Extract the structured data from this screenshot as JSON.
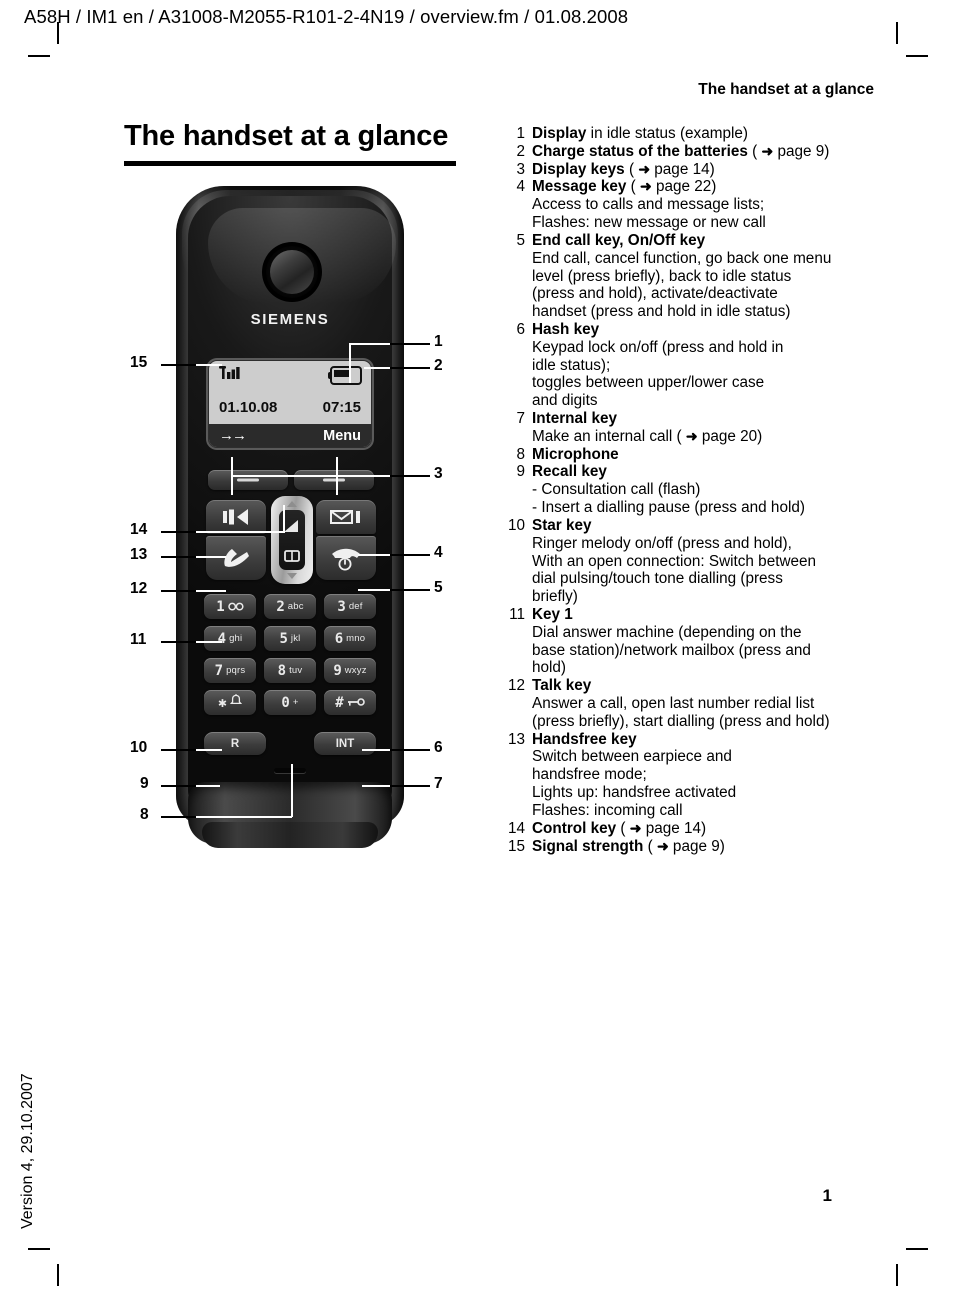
{
  "doc_header": "A58H / IM1 en / A31008-M2055-R101-2-4N19 / overview.fm / 01.08.2008",
  "section_header": "The handset at a glance",
  "page_title": "The handset at a glance",
  "page_number": "1",
  "version_footer": "Version 4, 29.10.2007",
  "arrow_glyph": "➜",
  "handset": {
    "brand": "SIEMENS",
    "display": {
      "date": "01.10.08",
      "time": "07:15",
      "softkey_left": "→→",
      "softkey_right": "Menu",
      "signal_icon": "signal-strength-icon",
      "battery_icon": "battery-icon"
    },
    "display_keys": [
      {
        "name": "display-key-left",
        "label": "—"
      },
      {
        "name": "display-key-right",
        "label": "—"
      }
    ],
    "function_keys": [
      {
        "name": "handsfree-key",
        "icon": "speaker-icon"
      },
      {
        "name": "talk-key",
        "icon": "handset-pickup-icon"
      },
      {
        "name": "message-key",
        "icon": "envelope-icon"
      },
      {
        "name": "end-call-key",
        "icon": "handset-hangup-power-icon"
      }
    ],
    "control_key": {
      "name": "control-key",
      "icon": "navigation-pad-icon"
    },
    "keypad": [
      [
        {
          "digit": "1",
          "letters": "∞",
          "icon": "answer-machine-icon"
        },
        {
          "digit": "2",
          "letters": "abc"
        },
        {
          "digit": "3",
          "letters": "def"
        }
      ],
      [
        {
          "digit": "4",
          "letters": "ghi"
        },
        {
          "digit": "5",
          "letters": "jkl"
        },
        {
          "digit": "6",
          "letters": "mno"
        }
      ],
      [
        {
          "digit": "7",
          "letters": "pqrs"
        },
        {
          "digit": "8",
          "letters": "tuv"
        },
        {
          "digit": "9",
          "letters": "wxyz"
        }
      ],
      [
        {
          "digit": "✱",
          "letters": "",
          "icon": "bell-icon"
        },
        {
          "digit": "0",
          "letters": "+"
        },
        {
          "digit": "#",
          "letters": "",
          "icon": "key-lock-icon"
        }
      ]
    ],
    "bottom_keys": [
      {
        "name": "recall-key",
        "label": "R"
      },
      {
        "name": "internal-key",
        "label": "INT"
      }
    ],
    "microphone": "microphone-slot"
  },
  "callouts": {
    "left": [
      "15",
      "14",
      "13",
      "12",
      "11",
      "10",
      "9",
      "8"
    ],
    "right": [
      "1",
      "2",
      "3",
      "4",
      "5",
      "6",
      "7"
    ]
  },
  "legend": [
    {
      "num": "1",
      "lines": [
        {
          "parts": [
            {
              "t": "Display",
              "b": true
            },
            {
              "t": " in idle status (example)"
            }
          ]
        }
      ]
    },
    {
      "num": "2",
      "lines": [
        {
          "parts": [
            {
              "t": "Charge status of the batteries",
              "b": true
            },
            {
              "t": " ( "
            },
            {
              "t": "➜",
              "arrow": true
            },
            {
              "t": "  page 9)"
            }
          ]
        }
      ]
    },
    {
      "num": "3",
      "lines": [
        {
          "parts": [
            {
              "t": "Display keys",
              "b": true
            },
            {
              "t": " ( "
            },
            {
              "t": "➜",
              "arrow": true
            },
            {
              "t": "  page 14)"
            }
          ]
        }
      ]
    },
    {
      "num": "4",
      "lines": [
        {
          "parts": [
            {
              "t": "Message key",
              "b": true
            },
            {
              "t": " ( "
            },
            {
              "t": "➜",
              "arrow": true
            },
            {
              "t": "  page 22)"
            }
          ]
        },
        {
          "parts": [
            {
              "t": "Access to calls and message lists;"
            }
          ]
        },
        {
          "parts": [
            {
              "t": "Flashes: new message or new call"
            }
          ]
        }
      ]
    },
    {
      "num": "5",
      "lines": [
        {
          "parts": [
            {
              "t": "End call key, On/Off key",
              "b": true
            }
          ]
        },
        {
          "parts": [
            {
              "t": "End call, cancel function, go back one menu"
            }
          ]
        },
        {
          "parts": [
            {
              "t": "level (press briefly), back to idle status"
            }
          ]
        },
        {
          "parts": [
            {
              "t": "(press and hold), activate/deactivate"
            }
          ]
        },
        {
          "parts": [
            {
              "t": "handset (press and hold in idle status)"
            }
          ]
        }
      ]
    },
    {
      "num": "6",
      "lines": [
        {
          "parts": [
            {
              "t": "Hash key",
              "b": true
            }
          ]
        },
        {
          "parts": [
            {
              "t": "Keypad lock on/off (press and hold in"
            }
          ]
        },
        {
          "parts": [
            {
              "t": "idle status);"
            }
          ]
        },
        {
          "parts": [
            {
              "t": "toggles between upper/lower case"
            }
          ]
        },
        {
          "parts": [
            {
              "t": "and digits"
            }
          ]
        }
      ]
    },
    {
      "num": "7",
      "lines": [
        {
          "parts": [
            {
              "t": "Internal key",
              "b": true
            }
          ]
        },
        {
          "parts": [
            {
              "t": "Make an internal call ( "
            },
            {
              "t": "➜",
              "arrow": true
            },
            {
              "t": "  page 20)"
            }
          ]
        }
      ]
    },
    {
      "num": "8",
      "lines": [
        {
          "parts": [
            {
              "t": "Microphone",
              "b": true
            }
          ]
        }
      ]
    },
    {
      "num": "9",
      "lines": [
        {
          "parts": [
            {
              "t": "Recall key",
              "b": true
            }
          ]
        },
        {
          "parts": [
            {
              "t": "- Consultation call (flash)"
            }
          ]
        },
        {
          "parts": [
            {
              "t": "- Insert a dialling pause (press and hold)"
            }
          ]
        }
      ]
    },
    {
      "num": "10",
      "lines": [
        {
          "parts": [
            {
              "t": "Star key",
              "b": true
            }
          ]
        },
        {
          "parts": [
            {
              "t": "Ringer melody on/off (press and hold),"
            }
          ]
        },
        {
          "parts": [
            {
              "t": "With an open connection: Switch between"
            }
          ]
        },
        {
          "parts": [
            {
              "t": "dial pulsing/touch tone dialling (press"
            }
          ]
        },
        {
          "parts": [
            {
              "t": "briefly)"
            }
          ]
        }
      ]
    },
    {
      "num": "11",
      "lines": [
        {
          "parts": [
            {
              "t": "Key 1",
              "b": true
            }
          ]
        },
        {
          "parts": [
            {
              "t": "Dial answer machine (depending on the"
            }
          ]
        },
        {
          "parts": [
            {
              "t": "base station)/network mailbox (press and"
            }
          ]
        },
        {
          "parts": [
            {
              "t": "hold)"
            }
          ]
        }
      ]
    },
    {
      "num": "12",
      "lines": [
        {
          "parts": [
            {
              "t": "Talk key",
              "b": true
            }
          ]
        },
        {
          "parts": [
            {
              "t": "Answer a call, open last number redial list"
            }
          ]
        },
        {
          "parts": [
            {
              "t": "(press briefly), start dialling (press and hold)"
            }
          ]
        }
      ]
    },
    {
      "num": "13",
      "lines": [
        {
          "parts": [
            {
              "t": "Handsfree key",
              "b": true
            }
          ]
        },
        {
          "parts": [
            {
              "t": "Switch between earpiece and"
            }
          ]
        },
        {
          "parts": [
            {
              "t": "handsfree mode;"
            }
          ]
        },
        {
          "parts": [
            {
              "t": "Lights up: handsfree activated"
            }
          ]
        },
        {
          "parts": [
            {
              "t": "Flashes: incoming call"
            }
          ]
        }
      ]
    },
    {
      "num": "14",
      "lines": [
        {
          "parts": [
            {
              "t": "Control key",
              "b": true
            },
            {
              "t": " ( "
            },
            {
              "t": "➜",
              "arrow": true
            },
            {
              "t": "  page 14)"
            }
          ]
        }
      ]
    },
    {
      "num": "15",
      "lines": [
        {
          "parts": [
            {
              "t": "Signal strength",
              "b": true
            },
            {
              "t": " ( "
            },
            {
              "t": "➜",
              "arrow": true
            },
            {
              "t": "  page 9)"
            }
          ]
        }
      ]
    }
  ]
}
